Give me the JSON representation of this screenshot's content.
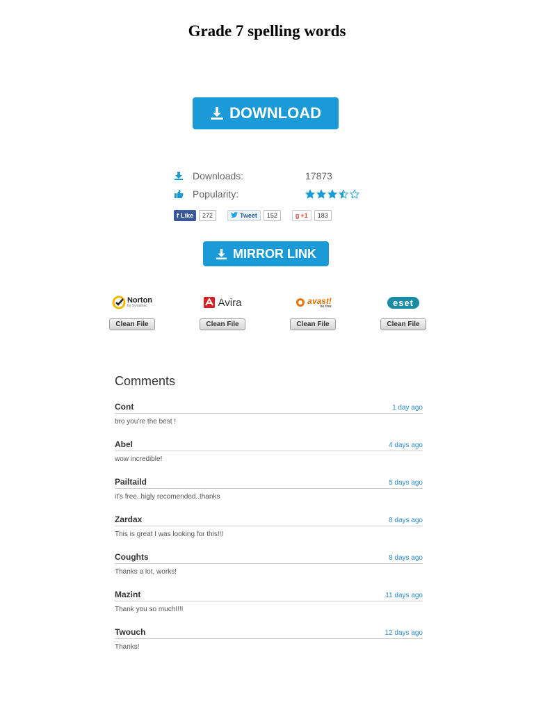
{
  "page": {
    "title": "Grade 7 spelling words"
  },
  "download_button": {
    "label": "DOWNLOAD",
    "color": "#1a9bd7"
  },
  "stats": {
    "downloads_label": "Downloads:",
    "downloads_value": "17873",
    "popularity_label": "Popularity:",
    "popularity_rating": 3.5,
    "popularity_max": 5
  },
  "social": {
    "facebook": {
      "label": "Like",
      "count": "272"
    },
    "twitter": {
      "label": "Tweet",
      "count": "152"
    },
    "googleplus": {
      "label": "+1",
      "count": "183"
    }
  },
  "mirror_button": {
    "label": "MIRROR LINK"
  },
  "antivirus": [
    {
      "name": "Norton",
      "sub": "by Symantec",
      "status": "Clean File"
    },
    {
      "name": "Avira",
      "status": "Clean File"
    },
    {
      "name": "avast!",
      "sub": "be free",
      "status": "Clean File"
    },
    {
      "name": "eset",
      "status": "Clean File"
    }
  ],
  "comments": {
    "title": "Comments",
    "items": [
      {
        "author": "Cont",
        "time": "1 day ago",
        "text": "bro you're the best !"
      },
      {
        "author": "Abel",
        "time": "4 days ago",
        "text": "wow incredible!"
      },
      {
        "author": "Pailtaild",
        "time": "5 days ago",
        "text": "it's free..higly recomended..thanks"
      },
      {
        "author": "Zardax",
        "time": "8 days ago",
        "text": "This is great I was looking for this!!!"
      },
      {
        "author": "Coughts",
        "time": "8 days ago",
        "text": "Thanks a lot, works!"
      },
      {
        "author": "Mazint",
        "time": "11 days ago",
        "text": "Thank you so much!!!!"
      },
      {
        "author": "Twouch",
        "time": "12 days ago",
        "text": "Thanks!"
      }
    ]
  }
}
